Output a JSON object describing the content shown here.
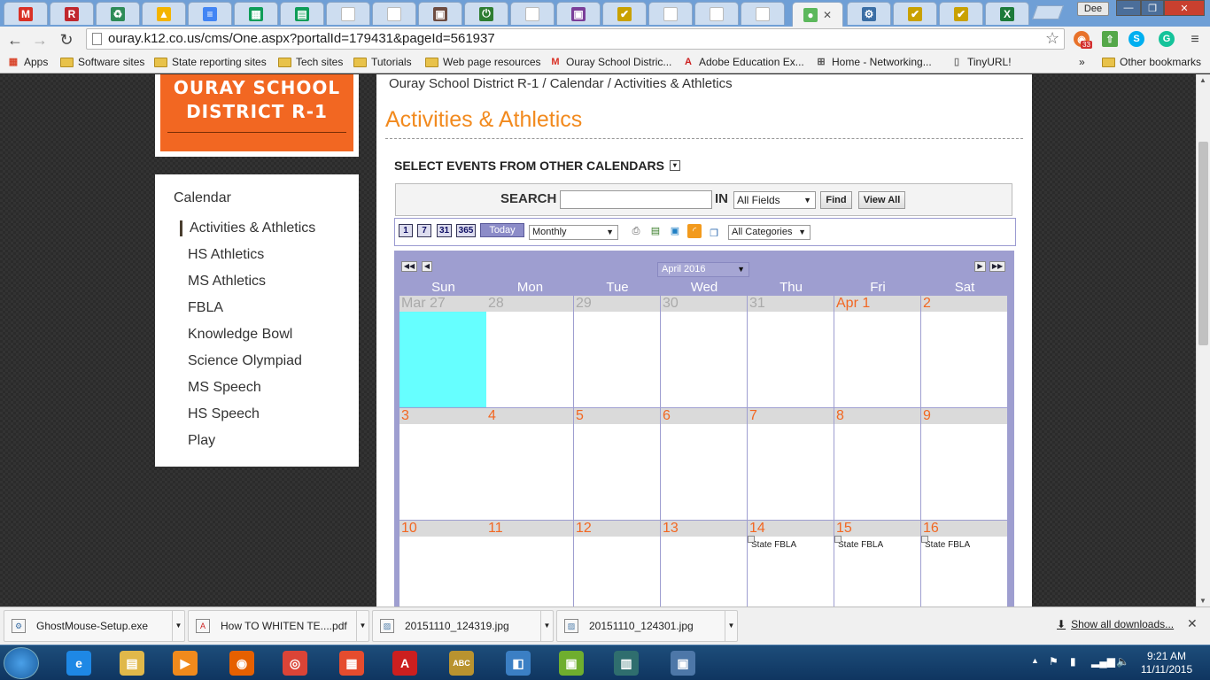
{
  "browser": {
    "tabs": [
      {
        "icon": "gmail-icon",
        "glyph": "M",
        "color": "#d93025"
      },
      {
        "icon": "r-app-icon",
        "glyph": "R",
        "color": "#c0272d"
      },
      {
        "icon": "recycle-icon",
        "glyph": "♻",
        "color": "#2e8b57"
      },
      {
        "icon": "google-drive-icon",
        "glyph": "▲",
        "color": "#f4b400"
      },
      {
        "icon": "google-docs-icon",
        "glyph": "≡",
        "color": "#4285f4"
      },
      {
        "icon": "google-sites-icon",
        "glyph": "▦",
        "color": "#0f9d58"
      },
      {
        "icon": "google-sheets-icon",
        "glyph": "▤",
        "color": "#0f9d58"
      },
      {
        "icon": "blank-page-icon",
        "glyph": "",
        "color": "#bbbbbb"
      },
      {
        "icon": "blank-page-icon",
        "glyph": "",
        "color": "#bbbbbb"
      },
      {
        "icon": "contact-icon",
        "glyph": "▣",
        "color": "#6d4c41"
      },
      {
        "icon": "power-icon",
        "glyph": "⏻",
        "color": "#2e7d32"
      },
      {
        "icon": "blank-page-icon",
        "glyph": "",
        "color": "#bbbbbb"
      },
      {
        "icon": "profile-app-icon",
        "glyph": "▣",
        "color": "#7b3f99"
      },
      {
        "icon": "check-icon",
        "glyph": "✔",
        "color": "#c9a100"
      },
      {
        "icon": "blank-page-icon",
        "glyph": "",
        "color": "#bbbbbb"
      },
      {
        "icon": "blank-page-icon",
        "glyph": "",
        "color": "#bbbbbb"
      },
      {
        "icon": "blank-page-icon",
        "glyph": "",
        "color": "#bbbbbb"
      },
      {
        "icon": "apple-icon",
        "glyph": "●",
        "color": "#5cb85c",
        "active": true
      },
      {
        "icon": "settings-app-icon",
        "glyph": "⚙",
        "color": "#3b6ea5"
      },
      {
        "icon": "check-icon",
        "glyph": "✔",
        "color": "#c9a100"
      },
      {
        "icon": "check-icon",
        "glyph": "✔",
        "color": "#c9a100"
      },
      {
        "icon": "excel-icon",
        "glyph": "X",
        "color": "#1d7a3a"
      }
    ],
    "profile_name": "Dee",
    "url": "ouray.k12.co.us/cms/One.aspx?portalId=179431&pageId=561937",
    "extension_badge": "33",
    "bookmarks": [
      {
        "label": "Apps",
        "icon": "apps-grid-icon"
      },
      {
        "label": "Software sites",
        "icon": "folder-icon"
      },
      {
        "label": "State reporting sites",
        "icon": "folder-icon"
      },
      {
        "label": "Tech sites",
        "icon": "folder-icon"
      },
      {
        "label": "Tutorials",
        "icon": "folder-icon"
      },
      {
        "label": "Web page resources",
        "icon": "folder-icon"
      },
      {
        "label": "Ouray School Distric...",
        "icon": "gmail-icon"
      },
      {
        "label": "Adobe Education Ex...",
        "icon": "adobe-icon"
      },
      {
        "label": "Home - Networking...",
        "icon": "network-icon"
      },
      {
        "label": "TinyURL!",
        "icon": "page-icon"
      }
    ],
    "bookmarks_overflow": "»",
    "other_bookmarks": "Other bookmarks"
  },
  "site": {
    "logo_line1": "OURAY SCHOOL",
    "logo_line2": "DISTRICT R-1",
    "nav_heading": "Calendar",
    "nav_items": [
      {
        "label": "Activities & Athletics",
        "current": true
      },
      {
        "label": "HS Athletics"
      },
      {
        "label": "MS Athletics"
      },
      {
        "label": "FBLA"
      },
      {
        "label": "Knowledge Bowl"
      },
      {
        "label": "Science Olympiad"
      },
      {
        "label": "MS Speech"
      },
      {
        "label": "HS Speech"
      },
      {
        "label": "Play"
      }
    ],
    "breadcrumb": "Ouray School District R-1 / Calendar / Activities & Athletics",
    "page_title": "Activities & Athletics",
    "select_events": "SELECT EVENTS FROM OTHER CALENDARS",
    "search": {
      "label": "SEARCH",
      "value": "",
      "in_label": "IN",
      "field_option": "All Fields",
      "find_label": "Find",
      "view_all_label": "View All"
    },
    "view_buttons": [
      "1",
      "7",
      "31",
      "365"
    ],
    "today_label": "Today",
    "view_mode": "Monthly",
    "category": "All Categories",
    "tool_icons": [
      "print-icon",
      "add-event-icon",
      "export-icon",
      "rss-icon",
      "copy-icon"
    ]
  },
  "calendar": {
    "month_label": "April 2016",
    "weekdays": [
      "Sun",
      "Mon",
      "Tue",
      "Wed",
      "Thu",
      "Fri",
      "Sat"
    ],
    "weeks": [
      [
        {
          "label": "Mar 27",
          "other": true,
          "today": true
        },
        {
          "label": "28",
          "other": true
        },
        {
          "label": "29",
          "other": true
        },
        {
          "label": "30",
          "other": true
        },
        {
          "label": "31",
          "other": true
        },
        {
          "label": "Apr 1"
        },
        {
          "label": "2"
        }
      ],
      [
        {
          "label": "3"
        },
        {
          "label": "4"
        },
        {
          "label": "5"
        },
        {
          "label": "6"
        },
        {
          "label": "7"
        },
        {
          "label": "8"
        },
        {
          "label": "9"
        }
      ],
      [
        {
          "label": "10"
        },
        {
          "label": "11"
        },
        {
          "label": "12"
        },
        {
          "label": "13"
        },
        {
          "label": "14",
          "event": "State FBLA"
        },
        {
          "label": "15",
          "event": "State FBLA"
        },
        {
          "label": "16",
          "event": "State FBLA"
        }
      ]
    ]
  },
  "downloads": {
    "items": [
      {
        "name": "GhostMouse-Setup.exe",
        "icon": "exe-file-icon"
      },
      {
        "name": "How TO WHITEN TE....pdf",
        "icon": "pdf-file-icon"
      },
      {
        "name": "20151110_124319.jpg",
        "icon": "image-file-icon"
      },
      {
        "name": "20151110_124301.jpg",
        "icon": "image-file-icon"
      }
    ],
    "show_all": "Show all downloads..."
  },
  "taskbar": {
    "apps": [
      {
        "icon": "internet-explorer-icon",
        "glyph": "e",
        "color": "#1e88e5"
      },
      {
        "icon": "file-explorer-icon",
        "glyph": "▤",
        "color": "#e0b84a"
      },
      {
        "icon": "media-player-icon",
        "glyph": "▶",
        "color": "#f08a1c"
      },
      {
        "icon": "firefox-icon",
        "glyph": "◉",
        "color": "#e66000"
      },
      {
        "icon": "chrome-icon",
        "glyph": "◎",
        "color": "#db4437"
      },
      {
        "icon": "start-apps-icon",
        "glyph": "▦",
        "color": "#e54c2e"
      },
      {
        "icon": "acrobat-icon",
        "glyph": "A",
        "color": "#cc1f1f"
      },
      {
        "icon": "spelling-app-icon",
        "glyph": "ABC",
        "color": "#b9932f"
      },
      {
        "icon": "remote-app-icon",
        "glyph": "◧",
        "color": "#3b7fc4"
      },
      {
        "icon": "vmware-icon",
        "glyph": "▣",
        "color": "#6fae2e"
      },
      {
        "icon": "tools-app-icon",
        "glyph": "▥",
        "color": "#2f6e6e"
      },
      {
        "icon": "network-app-icon",
        "glyph": "▣",
        "color": "#4d77a8"
      }
    ],
    "time": "9:21 AM",
    "date": "11/11/2015"
  }
}
